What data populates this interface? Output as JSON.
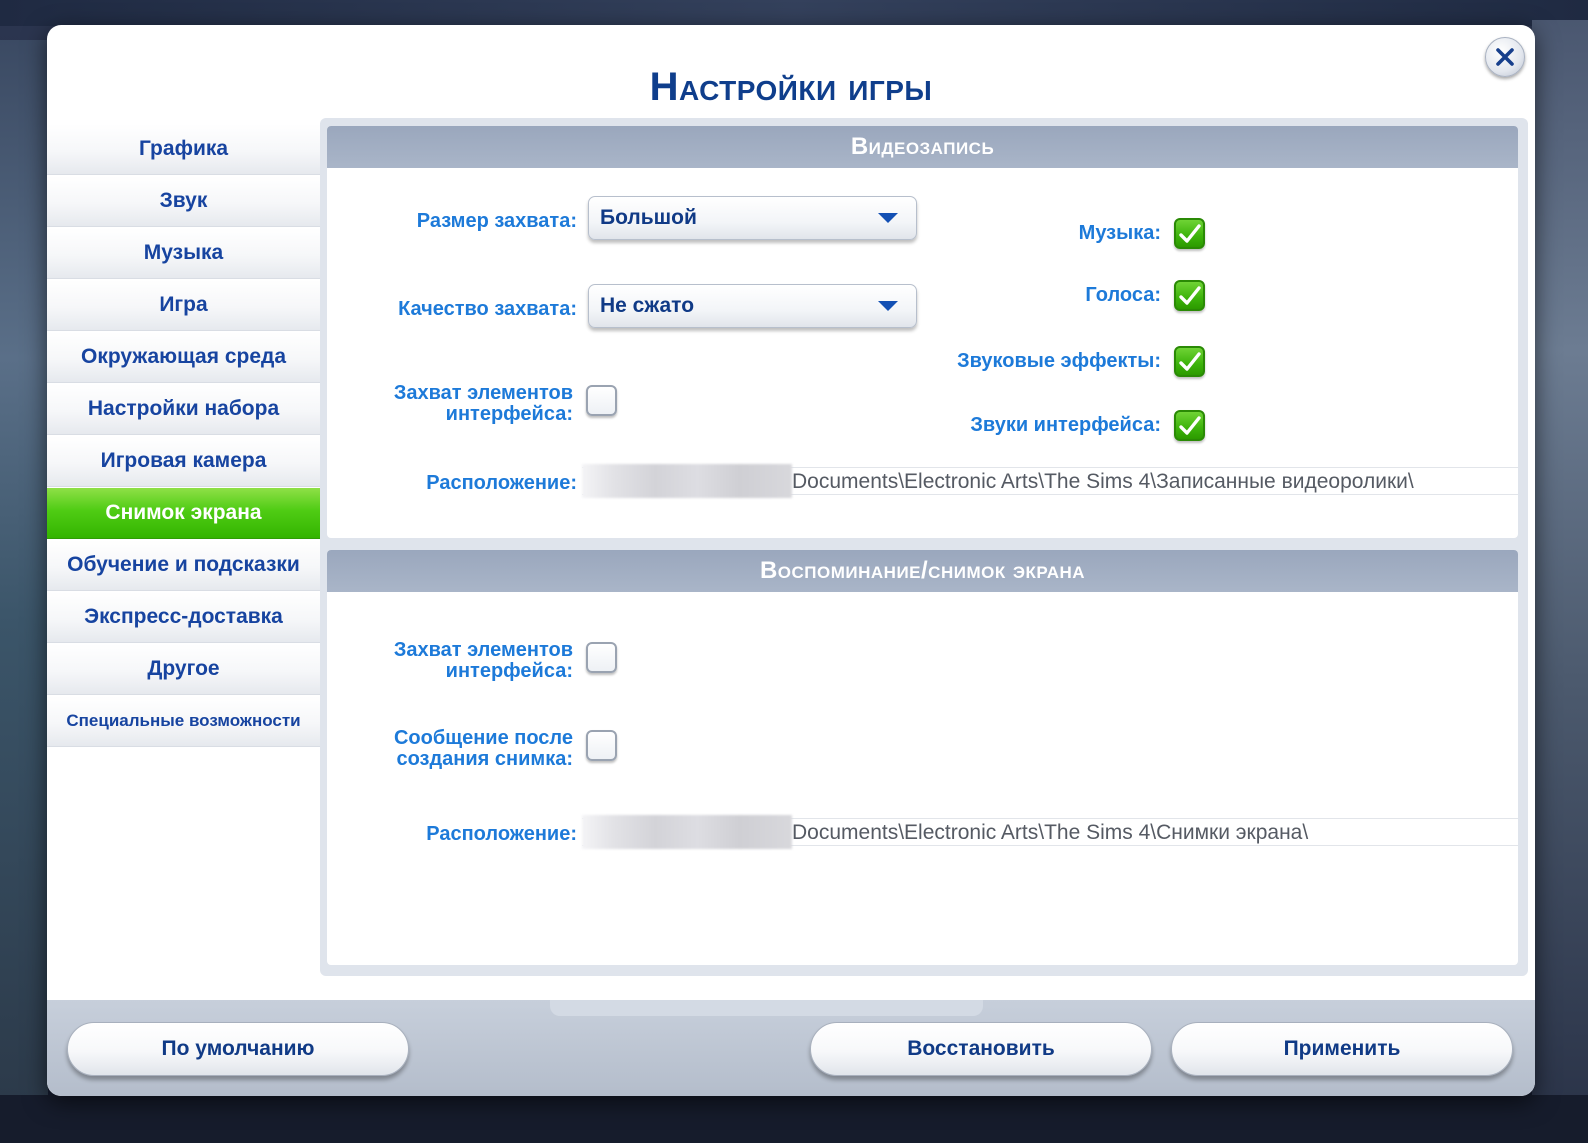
{
  "dialog": {
    "title": "Настройки игры",
    "close_icon": "close-icon"
  },
  "sidebar": {
    "items": [
      {
        "label": "Графика",
        "active": false
      },
      {
        "label": "Звук",
        "active": false
      },
      {
        "label": "Музыка",
        "active": false
      },
      {
        "label": "Игра",
        "active": false
      },
      {
        "label": "Окружающая среда",
        "active": false
      },
      {
        "label": "Настройки набора",
        "active": false
      },
      {
        "label": "Игровая камера",
        "active": false
      },
      {
        "label": "Снимок экрана",
        "active": true
      },
      {
        "label": "Обучение и подсказки",
        "active": false
      },
      {
        "label": "Экспресс-доставка",
        "active": false
      },
      {
        "label": "Другое",
        "active": false
      },
      {
        "label": "Специальные возможности",
        "active": false
      }
    ]
  },
  "video": {
    "header": "Видеозапись",
    "capture_size_label": "Размер захвата:",
    "capture_size_value": "Большой",
    "capture_quality_label": "Качество захвата:",
    "capture_quality_value": "Не сжато",
    "capture_ui_label_line1": "Захват элементов",
    "capture_ui_label_line2": "интерфейса:",
    "capture_ui_checked": false,
    "music_label": "Музыка:",
    "music_checked": true,
    "voices_label": "Голоса:",
    "voices_checked": true,
    "sfx_label": "Звуковые эффекты:",
    "sfx_checked": true,
    "ui_sounds_label": "Звуки интерфейса:",
    "ui_sounds_checked": true,
    "location_label": "Расположение:",
    "location_path": "Documents\\Electronic Arts\\The Sims 4\\Записанные видеоролики\\"
  },
  "memory": {
    "header": "Воспоминание/снимок экрана",
    "capture_ui_label_line1": "Захват элементов",
    "capture_ui_label_line2": "интерфейса:",
    "capture_ui_checked": false,
    "message_label_line1": "Сообщение после",
    "message_label_line2": "создания снимка:",
    "message_checked": false,
    "location_label": "Расположение:",
    "location_path": "Documents\\Electronic Arts\\The Sims 4\\Снимки экрана\\"
  },
  "footer": {
    "defaults_label": "По умолчанию",
    "restore_label": "Восстановить",
    "apply_label": "Применить"
  },
  "colors": {
    "accent_blue": "#1d7ad9",
    "title_blue": "#0f3e8c",
    "active_green": "#4fcc14"
  }
}
